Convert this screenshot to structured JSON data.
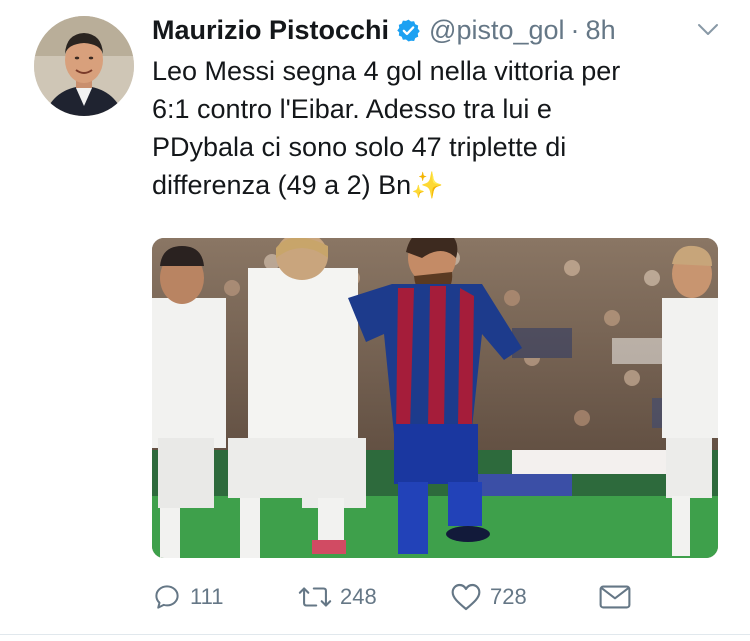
{
  "tweet": {
    "author_name": "Maurizio Pistocchi",
    "handle": "@pisto_gol",
    "separator": "·",
    "time": "8h",
    "verified": true,
    "text_lines": [
      "Leo Messi segna 4 gol nella vittoria per",
      "6:1 contro l'Eibar. Adesso tra lui e",
      "PDybala ci sono solo 47 triplette di",
      "differenza (49 a 2) Bn"
    ],
    "emoji": "✨",
    "actions": {
      "reply_count": "111",
      "retweet_count": "248",
      "like_count": "728"
    },
    "colors": {
      "verified_blue": "#1da1f2",
      "meta_gray": "#657786",
      "text": "#14171a"
    },
    "icons": {
      "reply": "reply-icon",
      "retweet": "retweet-icon",
      "like": "heart-icon",
      "dm": "envelope-icon",
      "menu": "chevron-down-icon",
      "verified": "verified-badge-icon"
    }
  }
}
